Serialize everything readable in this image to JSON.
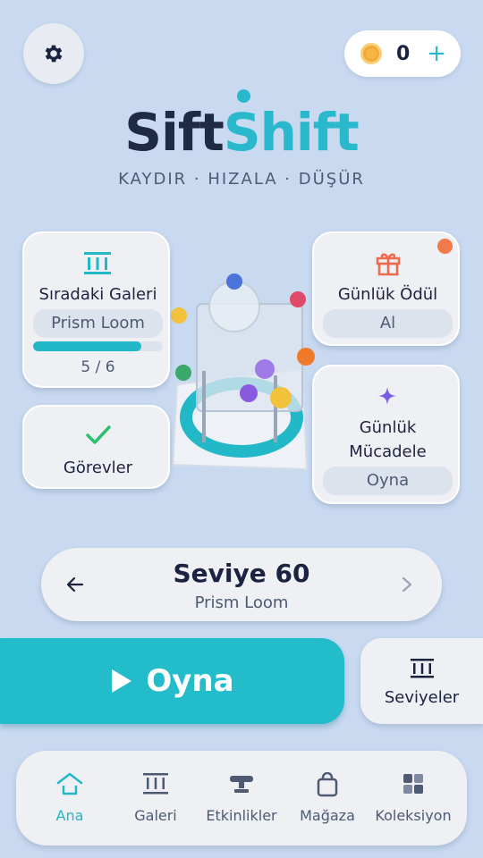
{
  "header": {
    "coins": "0",
    "coin_plus": "+"
  },
  "logo": {
    "part1": "Sift",
    "part2": "Shift",
    "tagline": "KAYDIR · HIZALA · DÜŞÜR"
  },
  "cards": {
    "next_gallery": {
      "title": "Sıradaki Galeri",
      "name": "Prism Loom",
      "progress_text": "5 / 6",
      "progress_fraction": 0.833
    },
    "tasks": {
      "title": "Görevler"
    },
    "daily_reward": {
      "title": "Günlük Ödül",
      "button": "Al"
    },
    "daily_challenge": {
      "title_line1": "Günlük",
      "title_line2": "Mücadele",
      "button": "Oyna"
    }
  },
  "level_selector": {
    "title": "Seviye 60",
    "subtitle": "Prism Loom"
  },
  "actions": {
    "play_label": "Oyna",
    "levels_label": "Seviyeler"
  },
  "nav": {
    "items": [
      {
        "label": "Ana",
        "icon": "home-icon",
        "active": true
      },
      {
        "label": "Galeri",
        "icon": "gallery-icon",
        "active": false
      },
      {
        "label": "Etkinlikler",
        "icon": "trophy-icon",
        "active": false
      },
      {
        "label": "Mağaza",
        "icon": "bag-icon",
        "active": false
      },
      {
        "label": "Koleksiyon",
        "icon": "collection-icon",
        "active": false
      }
    ]
  },
  "colors": {
    "background": "#c8d9f0",
    "accent": "#22b8c8",
    "dark": "#1c2340",
    "notification": "#f07a4a"
  }
}
